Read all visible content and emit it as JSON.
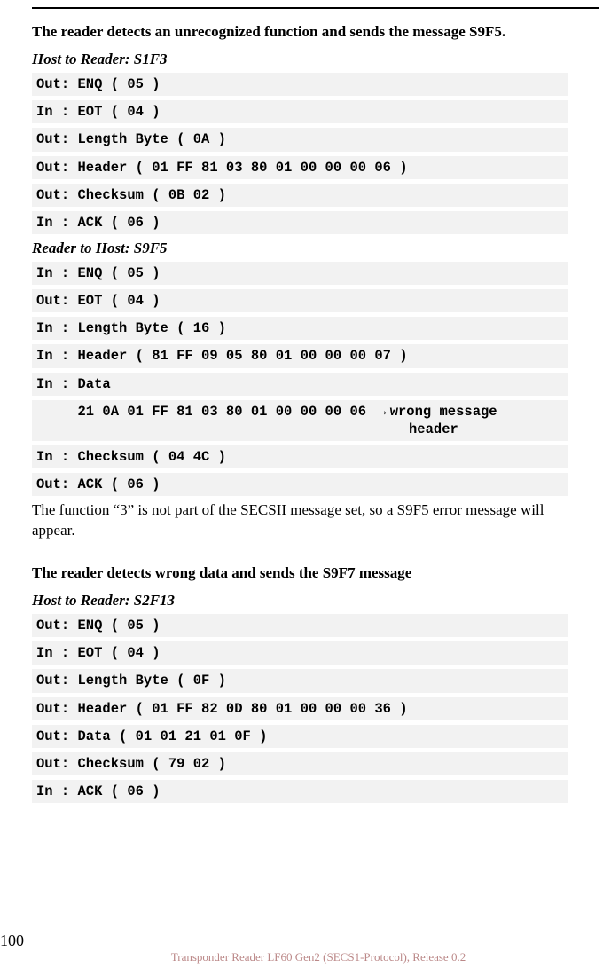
{
  "section1": {
    "heading": "The reader detects an unrecognized function and sends the message S9F5.",
    "sub1": "Host to Reader: S1F3",
    "code1": [
      "Out: ENQ ( 05 )",
      "In : EOT ( 04 )",
      "Out: Length Byte ( 0A )",
      "Out: Header ( 01 FF 81 03 80 01 00 00 00 06 )",
      "Out: Checksum ( 0B 02 )",
      "In : ACK ( 06 )"
    ],
    "sub2": "Reader to Host: S9F5",
    "code2a": [
      "In : ENQ ( 05 )",
      "Out: EOT ( 04 )",
      "In : Length Byte ( 16 )",
      "In : Header ( 81 FF 09 05 80 01 00 00 00 07 )",
      "In : Data"
    ],
    "code2_indent_hex": "     21 0A 01 FF 81 03 80 01 00 00 00 06 ",
    "code2_arrow": "→",
    "code2_annotation1": " wrong message",
    "code2_annotation2": "header",
    "code2b": [
      "In : Checksum ( 04 4C )",
      "Out: ACK ( 06 )"
    ],
    "body": "The function “3” is not part of the SECSII message set, so a S9F5 error message will appear."
  },
  "section2": {
    "heading": "The reader detects wrong data and sends the S9F7 message",
    "sub1": "Host to Reader: S2F13",
    "code1": [
      "Out: ENQ ( 05 )",
      "In : EOT ( 04 )",
      "Out: Length Byte ( 0F )",
      "Out: Header ( 01 FF 82 0D 80 01 00 00 00 36 )",
      "Out: Data ( 01 01 21 01 0F )",
      "Out: Checksum ( 79 02 )",
      "In : ACK ( 06 )"
    ]
  },
  "footer": {
    "page": "100",
    "text": "Transponder Reader LF60 Gen2 (SECS1-Protocol), Release 0.2"
  }
}
